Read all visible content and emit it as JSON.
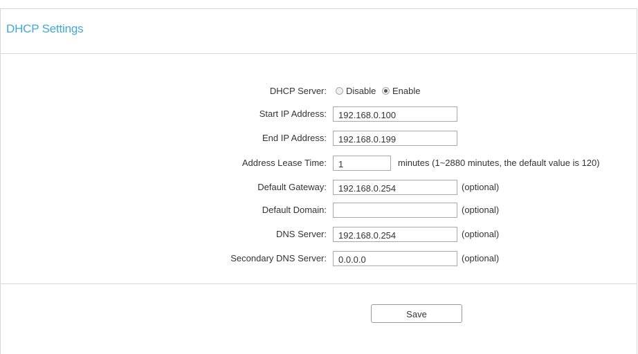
{
  "page": {
    "title": "DHCP Settings",
    "accent_color": "#3fa9d6"
  },
  "dhcp_server": {
    "label": "DHCP Server:",
    "options": [
      "Disable",
      "Enable"
    ],
    "selected": "Enable"
  },
  "fields": {
    "start_ip": {
      "label": "Start IP Address:",
      "value": "192.168.0.100"
    },
    "end_ip": {
      "label": "End IP Address:",
      "value": "192.168.0.199"
    },
    "lease_time": {
      "label": "Address Lease Time:",
      "value": "1",
      "hint": "minutes (1~2880 minutes, the default value is 120)"
    },
    "gateway": {
      "label": "Default Gateway:",
      "value": "192.168.0.254",
      "hint": "(optional)"
    },
    "domain": {
      "label": "Default Domain:",
      "value": "",
      "hint": "(optional)"
    },
    "dns": {
      "label": "DNS Server:",
      "value": "192.168.0.254",
      "hint": "(optional)"
    },
    "secondary_dns": {
      "label": "Secondary DNS Server:",
      "value": "0.0.0.0",
      "hint": "(optional)"
    }
  },
  "actions": {
    "save_label": "Save"
  }
}
